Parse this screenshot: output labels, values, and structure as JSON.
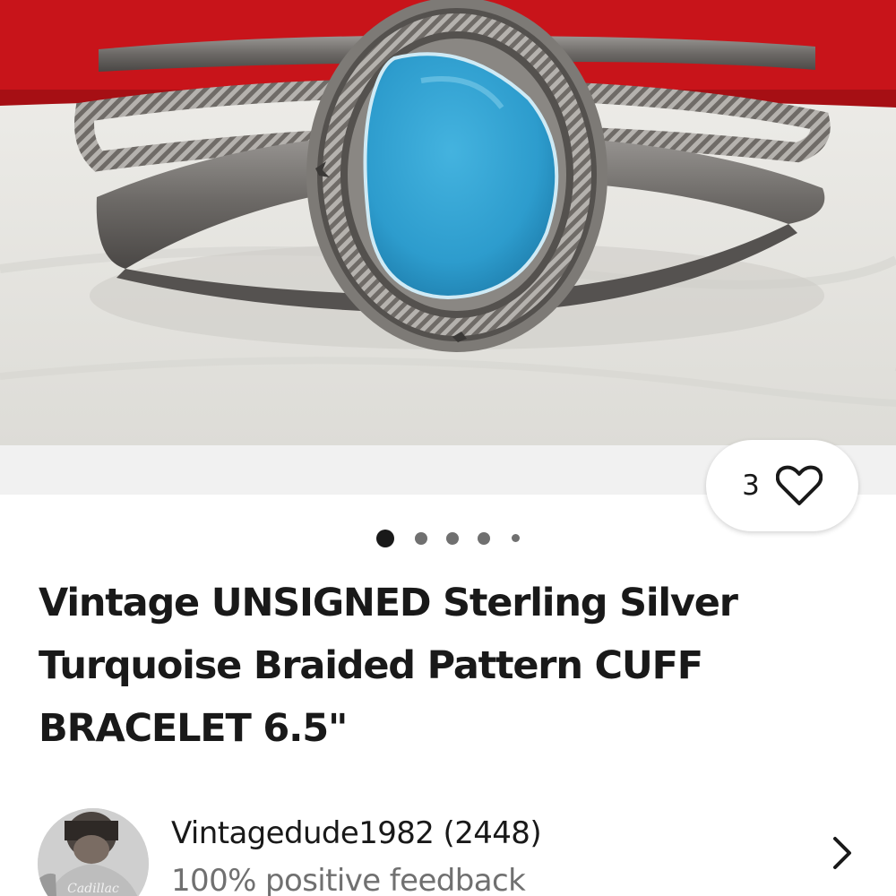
{
  "listing": {
    "title": "Vintage UNSIGNED Sterling Silver Turquoise Braided Pattern CUFF BRACELET 6.5\"",
    "watch_count": "3",
    "image_carousel": {
      "total_dots_visible": 5,
      "active_index": 0
    }
  },
  "seller": {
    "name_line": "Vintagedude1982 (2448)",
    "feedback": "100% positive feedback",
    "avatar_shirt_text": "Cadillac Wheels"
  },
  "icons": {
    "watch": "heart-outline-icon",
    "seller_link": "chevron-right-icon"
  },
  "colors": {
    "text_primary": "#191919",
    "text_secondary": "#707070",
    "photo_backdrop_red": "#c8141a",
    "turquoise": "#2f9fcf"
  }
}
